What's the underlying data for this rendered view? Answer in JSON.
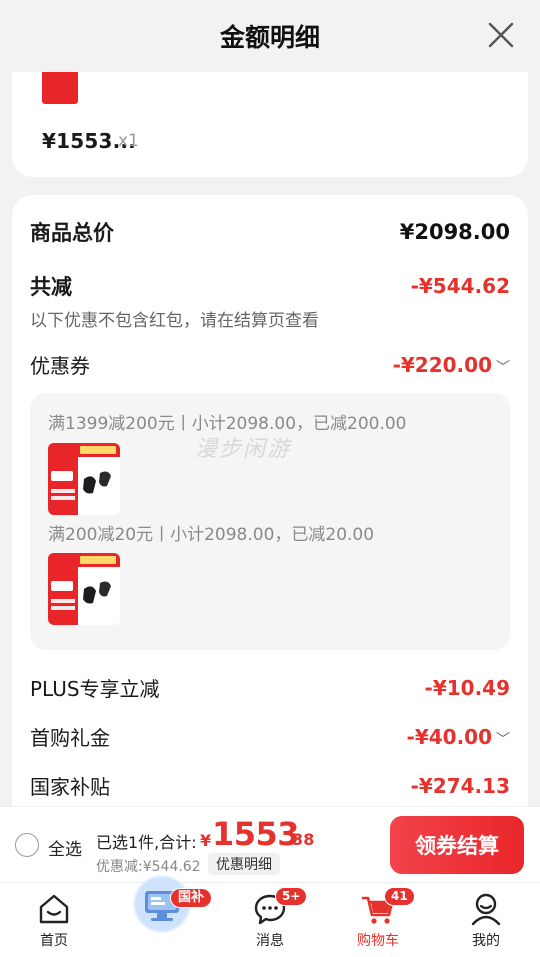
{
  "header": {
    "title": "金额明细"
  },
  "product": {
    "price": "¥1553...",
    "qty": "x1"
  },
  "summary": {
    "total_label": "商品总价",
    "total_value": "¥2098.00",
    "reduce_label": "共减",
    "reduce_value": "-¥544.62",
    "note": "以下优惠不包含红包，请在结算页查看"
  },
  "coupon": {
    "label": "优惠券",
    "value": "-¥220.00",
    "lines": [
      "满1399减200元丨小计2098.00，已减200.00",
      "满200减20元丨小计2098.00，已减20.00"
    ],
    "watermark": "漫步闲游"
  },
  "discounts": [
    {
      "label": "PLUS专享立减",
      "value": "-¥10.49",
      "chevron": false
    },
    {
      "label": "首购礼金",
      "value": "-¥40.00",
      "chevron": true
    },
    {
      "label": "国家补贴",
      "value": "-¥274.13",
      "chevron": false
    }
  ],
  "checkout": {
    "select_all": "全选",
    "summary": "已选1件,合计:",
    "currency": "¥",
    "total_int": "1553",
    "total_dec": ".38",
    "discount": "优惠减:¥544.62",
    "detail_chip": "优惠明细",
    "button": "领券结算"
  },
  "tabs": [
    {
      "label": "首页",
      "icon": "home-icon"
    },
    {
      "label": "国补",
      "icon": "subsidy-icon"
    },
    {
      "label": "消息",
      "icon": "message-icon",
      "badge": "5+"
    },
    {
      "label": "购物车",
      "icon": "cart-icon",
      "badge": "41",
      "active": true
    },
    {
      "label": "我的",
      "icon": "profile-icon"
    }
  ],
  "colors": {
    "accent": "#e5322d",
    "background": "#f2f2f2"
  }
}
